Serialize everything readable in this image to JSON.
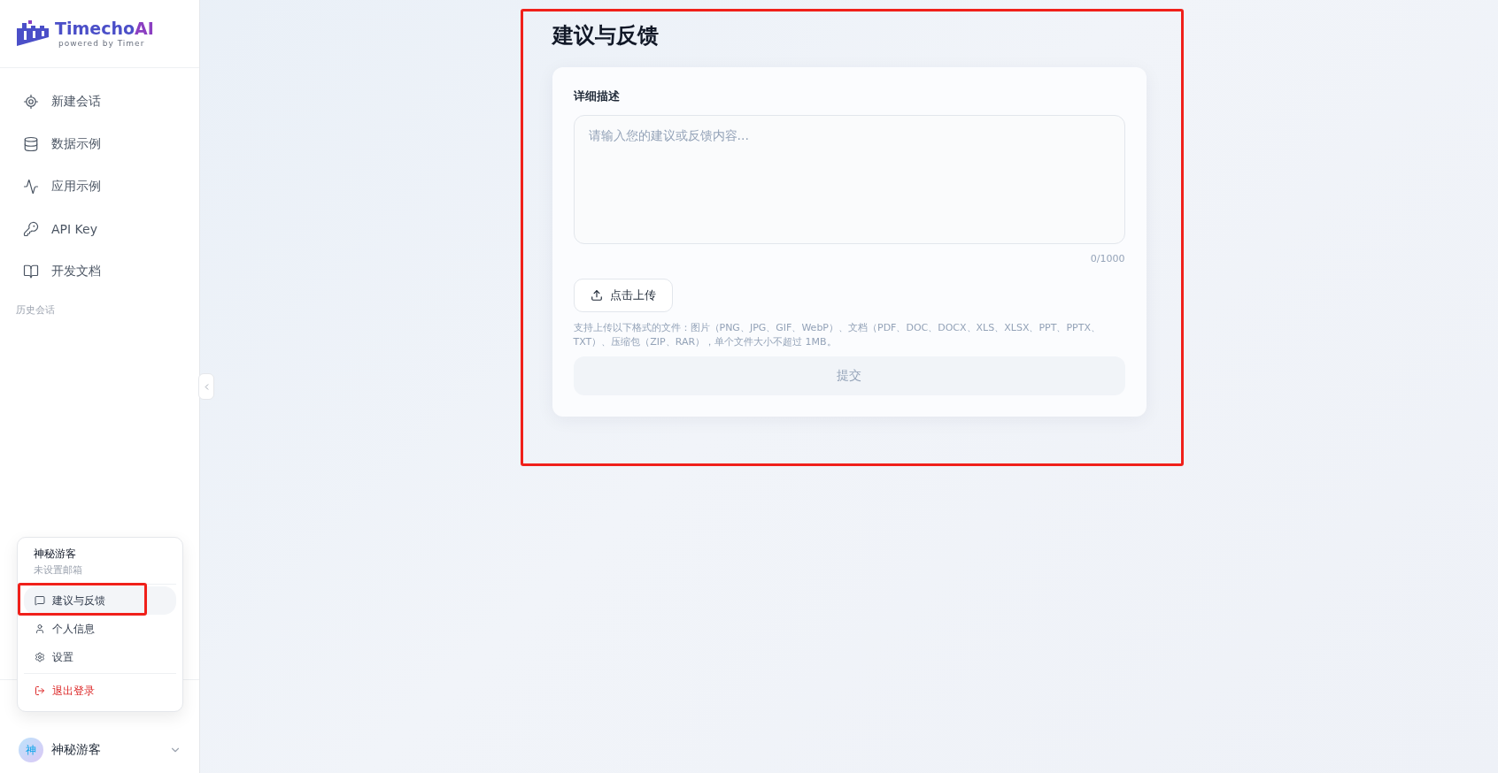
{
  "logo": {
    "name_main": "Timecho",
    "name_accent": "AI",
    "tagline": "powered by Timer"
  },
  "nav": [
    {
      "label": "新建会话"
    },
    {
      "label": "数据示例"
    },
    {
      "label": "应用示例"
    },
    {
      "label": "API Key"
    },
    {
      "label": "开发文档"
    }
  ],
  "history_label": "历史会话",
  "user_menu": {
    "name": "神秘游客",
    "email": "未设置邮箱",
    "items": [
      {
        "label": "建议与反馈",
        "selected": true,
        "annotated": true
      },
      {
        "label": "个人信息",
        "selected": false,
        "annotated": false
      },
      {
        "label": "设置",
        "selected": false,
        "annotated": false
      }
    ],
    "logout": "退出登录"
  },
  "user": {
    "avatar": "神",
    "name": "神秘游客"
  },
  "page": {
    "title": "建议与反馈",
    "annotated": true
  },
  "form": {
    "label": "详细描述",
    "placeholder": "请输入您的建议或反馈内容...",
    "counter": "0/1000",
    "upload": "点击上传",
    "hint": "支持上传以下格式的文件：图片（PNG、JPG、GIF、WebP）、文档（PDF、DOC、DOCX、XLS、XLSX、PPT、PPTX、TXT）、压缩包（ZIP、RAR），单个文件大小不超过 1MB。",
    "submit": {
      "label": "提交",
      "disabled": true
    }
  }
}
